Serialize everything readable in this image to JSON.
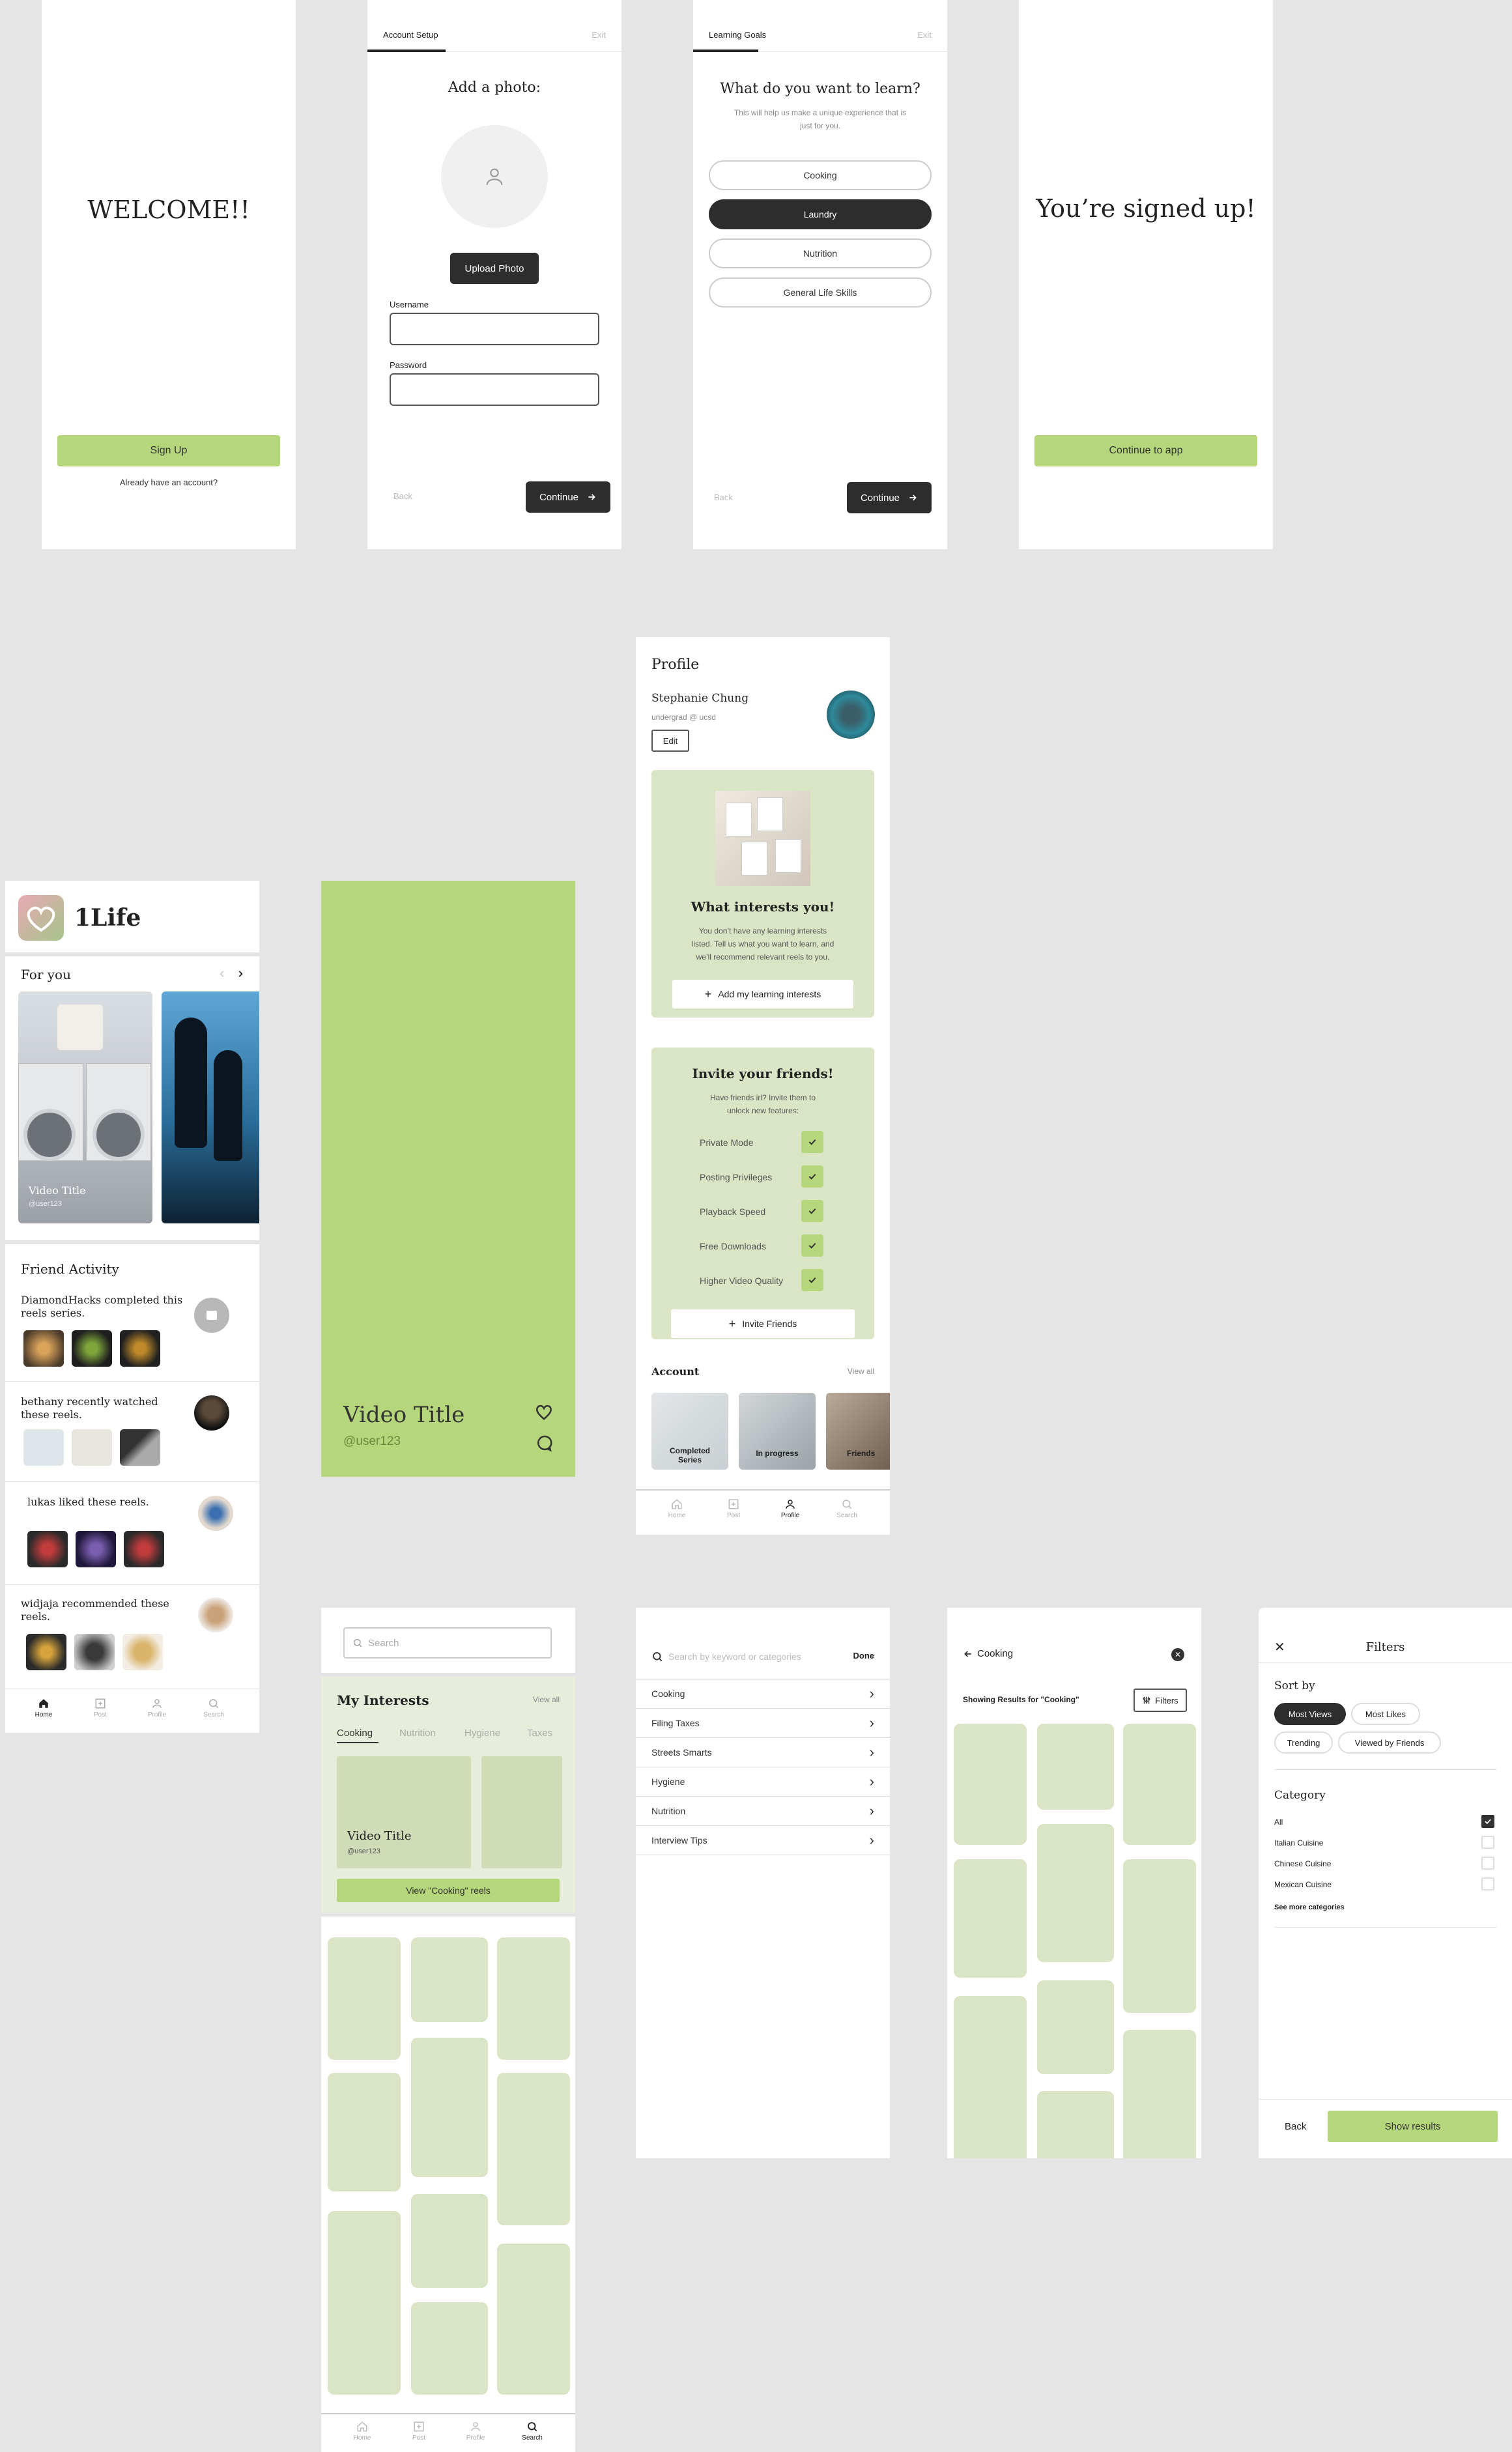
{
  "welcome": {
    "heading": "WELCOME!!",
    "signup": "Sign Up",
    "login_link": "Already have an account?"
  },
  "account_setup": {
    "tab": "Account Setup",
    "exit": "Exit",
    "heading": "Add a photo:",
    "upload": "Upload Photo",
    "username_label": "Username",
    "password_label": "Password",
    "back": "Back",
    "continue": "Continue"
  },
  "learning_goals": {
    "tab": "Learning Goals",
    "exit": "Exit",
    "heading": "What do you want to learn?",
    "subtitle_1": "This will help us make a unique experience that is",
    "subtitle_2": "just for you.",
    "options": [
      "Cooking",
      "Laundry",
      "Nutrition",
      "General Life Skills"
    ],
    "back": "Back",
    "continue": "Continue"
  },
  "signed_up": {
    "heading": "You’re signed up!",
    "continue": "Continue to app"
  },
  "home": {
    "logo": "1Life",
    "for_you": "For you",
    "card": {
      "title": "Video Title",
      "user": "@user123"
    },
    "friend_activity": "Friend Activity",
    "activities": [
      {
        "text": "DiamondHacks completed this reels series."
      },
      {
        "text": "bethany recently watched these reels."
      },
      {
        "text": "lukas liked these reels."
      },
      {
        "text": "widjaja recommended these reels."
      }
    ],
    "nav": [
      "Home",
      "Post",
      "Profile",
      "Search"
    ]
  },
  "video": {
    "title": "Video Title",
    "user": "@user123"
  },
  "profile": {
    "heading": "Profile",
    "name": "Stephanie Chung",
    "bio": "undergrad @ ucsd",
    "edit": "Edit",
    "interests_title": "What interests you!",
    "interests_text_1": "You don’t have any learning interests",
    "interests_text_2": "listed. Tell us what you want to learn, and",
    "interests_text_3": "we’ll recommend relevant reels to you.",
    "add_interests": "Add my learning interests",
    "invite_title": "Invite your friends!",
    "invite_text_1": "Have friends irl? Invite them to",
    "invite_text_2": "unlock new features:",
    "features": [
      "Private Mode",
      "Posting Privileges",
      "Playback Speed",
      "Free Downloads",
      "Higher Video Quality"
    ],
    "invite_button": "Invite Friends",
    "account": "Account",
    "view_all": "View all",
    "account_cards": [
      "Completed Series",
      "In progress",
      "Friends"
    ],
    "nav": [
      "Home",
      "Post",
      "Profile",
      "Search"
    ]
  },
  "search_page": {
    "placeholder": "Search",
    "my_interests": "My Interests",
    "view_all": "View all",
    "tabs": [
      "Cooking",
      "Nutrition",
      "Hygiene",
      "Taxes"
    ],
    "card": {
      "title": "Video Title",
      "user": "@user123"
    },
    "view_button": "View \"Cooking\" reels",
    "nav": [
      "Home",
      "Post",
      "Profile",
      "Search"
    ]
  },
  "categories": {
    "placeholder": "Search by keyword or categories",
    "done": "Done",
    "items": [
      "Cooking",
      "Filing Taxes",
      "Streets Smarts",
      "Hygiene",
      "Nutrition",
      "Interview Tips"
    ]
  },
  "results": {
    "query": "Cooking",
    "showing": "Showing Results for \"Cooking\"",
    "filters": "Filters"
  },
  "filters": {
    "title": "Filters",
    "sort_by": "Sort by",
    "sort_options": [
      "Most Views",
      "Most Likes",
      "Trending",
      "Viewed by Friends"
    ],
    "category": "Category",
    "categories": [
      "All",
      "Italian Cuisine",
      "Chinese Cuisine",
      "Mexican Cuisine"
    ],
    "see_more": "See more categories",
    "back": "Back",
    "show_results": "Show results"
  },
  "colors": {
    "accent": "#b5d67a",
    "pale_green": "#d9e5c4",
    "dark": "#2d2d2d",
    "canvas": "#e5e5e5"
  }
}
